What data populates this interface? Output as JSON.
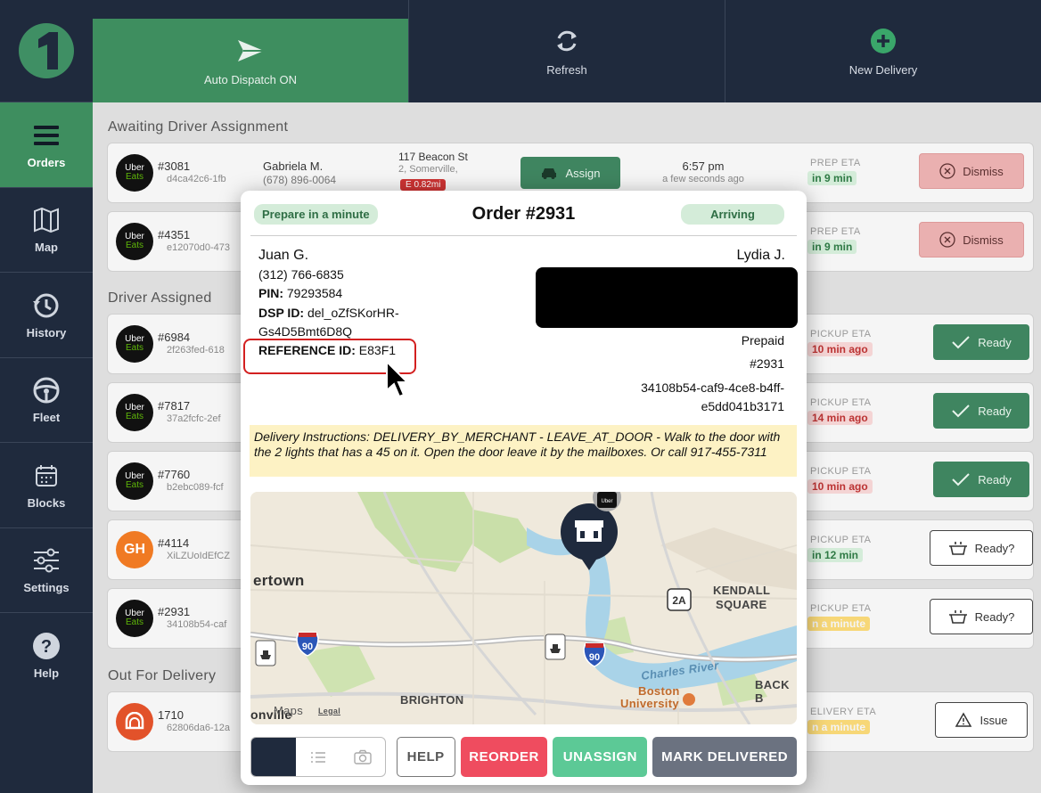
{
  "sidebar": {
    "items": [
      {
        "label": "Orders",
        "icon": "menu-icon",
        "active": true
      },
      {
        "label": "Map",
        "icon": "map-icon"
      },
      {
        "label": "History",
        "icon": "history-icon"
      },
      {
        "label": "Fleet",
        "icon": "steering-wheel-icon"
      },
      {
        "label": "Blocks",
        "icon": "calendar-icon"
      },
      {
        "label": "Settings",
        "icon": "sliders-icon"
      },
      {
        "label": "Help",
        "icon": "help-icon"
      }
    ]
  },
  "topbar": {
    "auto_dispatch": "Auto Dispatch ON",
    "refresh": "Refresh",
    "new_delivery": "New Delivery"
  },
  "sections": {
    "awaiting": "Awaiting Driver Assignment",
    "assigned": "Driver Assigned",
    "out": "Out For Delivery"
  },
  "orders": [
    {
      "no": "#3081",
      "id": "d4ca42c6-1fb",
      "name": "Gabriela M.",
      "phone": "(678) 896-0064",
      "address": "117 Beacon St",
      "city": "2, Somerville,",
      "distance": "E 0.82mi",
      "assign": "Assign",
      "time": "6:57 pm",
      "ago": "a few seconds ago",
      "eta_label": "PREP ETA",
      "eta": "in 9 min",
      "action": "Dismiss"
    },
    {
      "no": "#4351",
      "id": "e12070d0-473",
      "eta_label": "PREP ETA",
      "eta": "in 9 min",
      "action": "Dismiss"
    },
    {
      "no": "#6984",
      "id": "2f263fed-618",
      "eta_label": "PICKUP ETA",
      "eta": "10 min ago",
      "action": "Ready"
    },
    {
      "no": "#7817",
      "id": "37a2fcfc-2ef",
      "eta_label": "PICKUP ETA",
      "eta": "14 min ago",
      "action": "Ready"
    },
    {
      "no": "#7760",
      "id": "b2ebc089-fcf",
      "eta_label": "PICKUP ETA",
      "eta": "10 min ago",
      "action": "Ready"
    },
    {
      "no": "#4114",
      "id": "XiLZUoIdEfCZ",
      "eta_label": "PICKUP ETA",
      "eta": "in 12 min",
      "action": "Ready?"
    },
    {
      "no": "#2931",
      "id": "34108b54-caf",
      "eta_label": "PICKUP ETA",
      "eta": "n a minute",
      "action": "Ready?"
    },
    {
      "no": "1710",
      "id": "62806da6-12a",
      "eta_label": "ELIVERY ETA",
      "eta": "n a minute",
      "action": "Issue"
    }
  ],
  "badges": {
    "uber_top": "Uber",
    "uber_bottom": "Eats",
    "gh": "GH"
  },
  "modal": {
    "prep_pill": "Prepare in a minute",
    "title": "Order #2931",
    "status_pill": "Arriving",
    "customer": {
      "name": "Juan G.",
      "phone": "(312) 766-6835",
      "pin_label": "PIN:",
      "pin": "79293584",
      "dsp_label": "DSP ID:",
      "dsp_1": "del_oZfSKorHR-",
      "dsp_2": "Gs4D5Bmt6D8Q",
      "ref_label": "REFERENCE ID:",
      "ref": "E83F1"
    },
    "driver": {
      "name": "Lydia J.",
      "payment": "Prepaid",
      "order_no": "#2931",
      "uuid_1": "34108b54-caf9-4ce8-b4ff-",
      "uuid_2": "e5dd041b3171"
    },
    "instructions": "Delivery Instructions: DELIVERY_BY_MERCHANT - LEAVE_AT_DOOR - Walk to the door with the 2 lights that has a 45 on it. Open the door leave it by the mailboxes. Or call 917-455-7311",
    "map": {
      "labels": {
        "watertown": "ertown",
        "kendall_1": "KENDALL",
        "kendall_2": "SQUARE",
        "brighton": "BRIGHTON",
        "charles": "Charles River",
        "boston_1": "Boston",
        "boston_2": "University",
        "backbay": "BACK B",
        "ville": "onville",
        "maps": "Maps",
        "legal": "Legal",
        "route_2a": "2A",
        "i90": "90",
        "uber_marker": "Uber"
      }
    },
    "footer": {
      "help": "HELP",
      "reorder": "REORDER",
      "unassign": "UNASSIGN",
      "mark_delivered": "MARK DELIVERED"
    }
  },
  "colors": {
    "sidebar": "#1f2a3d",
    "accent_green": "#3e8e5f",
    "dismiss": "#eab0b0",
    "reorder": "#ef4c5f",
    "unassign": "#5cc996",
    "delivered": "#6b7280"
  }
}
